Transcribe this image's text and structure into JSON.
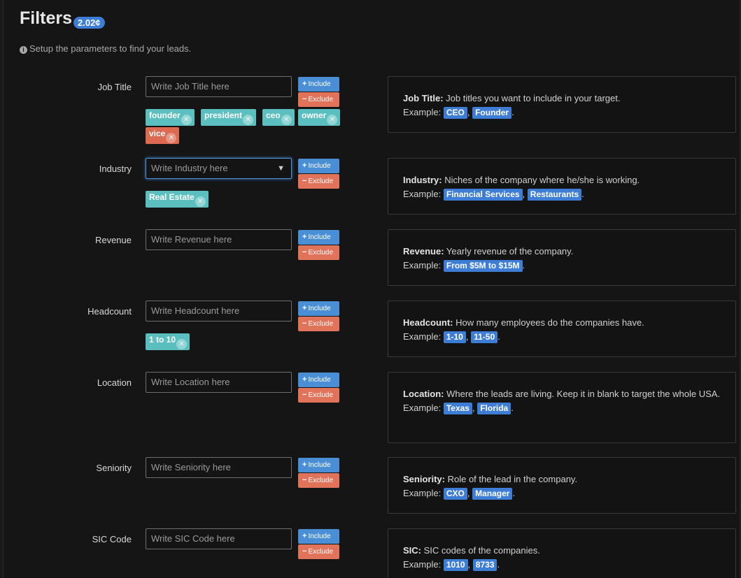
{
  "header": {
    "title": "Filters",
    "price": "2.02¢",
    "subtitle": "Setup the parameters to find your leads."
  },
  "buttons": {
    "include": "Include",
    "exclude": "Exclude"
  },
  "filters": {
    "job_title": {
      "label": "Job Title",
      "placeholder": "Write Job Title here",
      "tags": [
        "founder",
        "president",
        "ceo",
        "owner"
      ],
      "excluded_tags": [
        "vice"
      ],
      "help_title": "Job Title:",
      "help_text": "Job titles you want to include in your target.",
      "example_label": "Example:",
      "examples": [
        "CEO",
        "Founder"
      ]
    },
    "industry": {
      "label": "Industry",
      "placeholder": "Write Industry here",
      "tags": [
        "Real Estate"
      ],
      "help_title": "Industry:",
      "help_text": "Niches of the company where he/she is working.",
      "example_label": "Example:",
      "examples": [
        "Financial Services",
        "Restaurants"
      ]
    },
    "revenue": {
      "label": "Revenue",
      "placeholder": "Write Revenue here",
      "help_title": "Revenue:",
      "help_text": "Yearly revenue of the company.",
      "example_label": "Example:",
      "examples": [
        "From $5M to $15M"
      ]
    },
    "headcount": {
      "label": "Headcount",
      "placeholder": "Write Headcount here",
      "tags": [
        "1 to 10"
      ],
      "help_title": "Headcount:",
      "help_text": "How many employees do the companies have.",
      "example_label": "Example:",
      "examples": [
        "1-10",
        "11-50"
      ]
    },
    "location": {
      "label": "Location",
      "placeholder": "Write Location here",
      "help_title": "Location:",
      "help_text": "Where the leads are living. Keep it in blank to target the whole USA.",
      "example_label": "Example:",
      "examples": [
        "Texas",
        "Florida"
      ]
    },
    "seniority": {
      "label": "Seniority",
      "placeholder": "Write Seniority here",
      "help_title": "Seniority:",
      "help_text": "Role of the lead in the company.",
      "example_label": "Example:",
      "examples": [
        "CXO",
        "Manager"
      ]
    },
    "sic_code": {
      "label": "SIC Code",
      "placeholder": "Write SIC Code here",
      "help_title": "SIC:",
      "help_text": "SIC codes of the companies.",
      "example_label": "Example:",
      "examples": [
        "1010",
        "8733"
      ]
    }
  }
}
